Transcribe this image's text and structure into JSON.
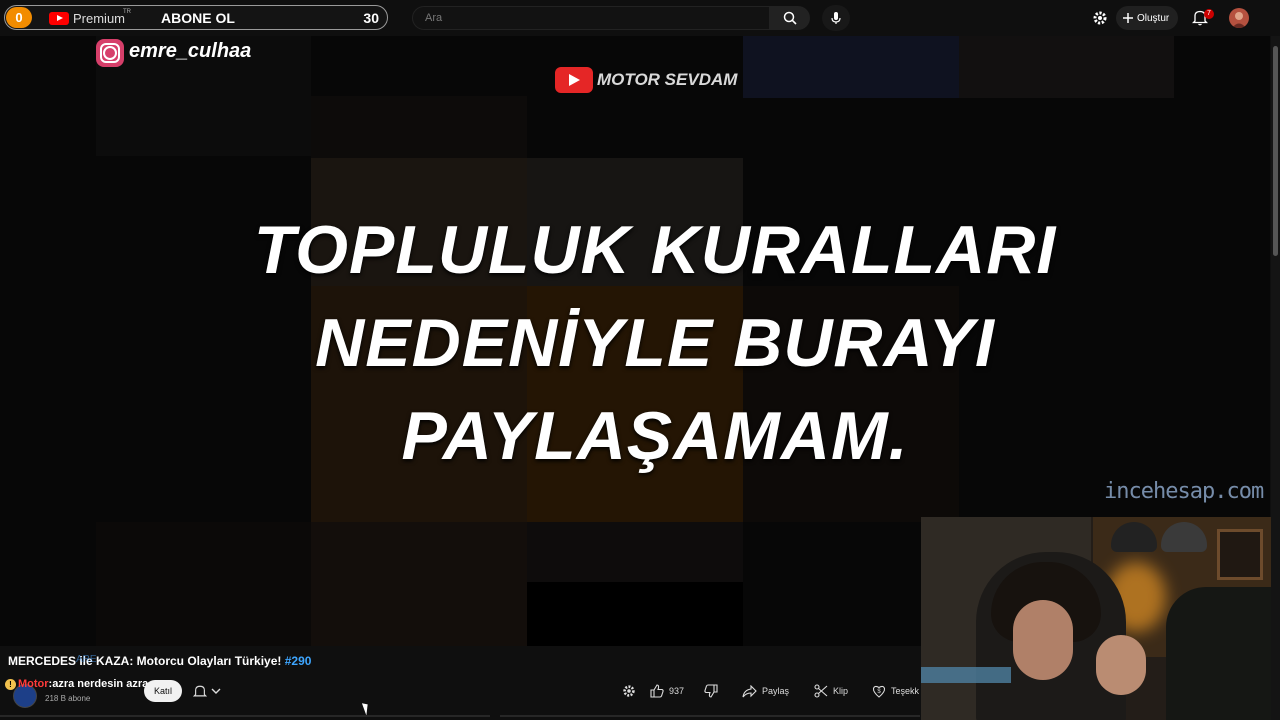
{
  "subscribe_widget": {
    "counter_left": "0",
    "brand": "Premium",
    "region": "TR",
    "cta": "ABONE OL",
    "count": "30"
  },
  "search": {
    "placeholder": "Ara"
  },
  "header": {
    "create_label": "Oluştur",
    "notification_count": "7"
  },
  "video": {
    "instagram_handle": "emre_culhaa",
    "channel_logo_text": "MOTOR SEVDAM",
    "notice_lines": [
      "TOPLULUK KURALLARI",
      "NEDENİYLE BURAYI",
      "PAYLAŞAMAM."
    ],
    "watermark": "incehesap.com"
  },
  "below_video": {
    "title": "MERCEDES ile KAZA: Motorcu Olayları Türkiye!",
    "title_tag": "#290",
    "overlay_prefix": "ARE",
    "chat_user": "Motor",
    "chat_message": "azra nerdesin azra",
    "subscriber_count": "218 B abone",
    "join_label": "Katıl",
    "like_count": "937",
    "share_label": "Paylaş",
    "clip_label": "Klip",
    "thanks_label": "Teşekk"
  },
  "colors": {
    "accent_red": "#ff0000",
    "link_blue": "#3ea6ff",
    "counter_orange": "#f28c00"
  }
}
